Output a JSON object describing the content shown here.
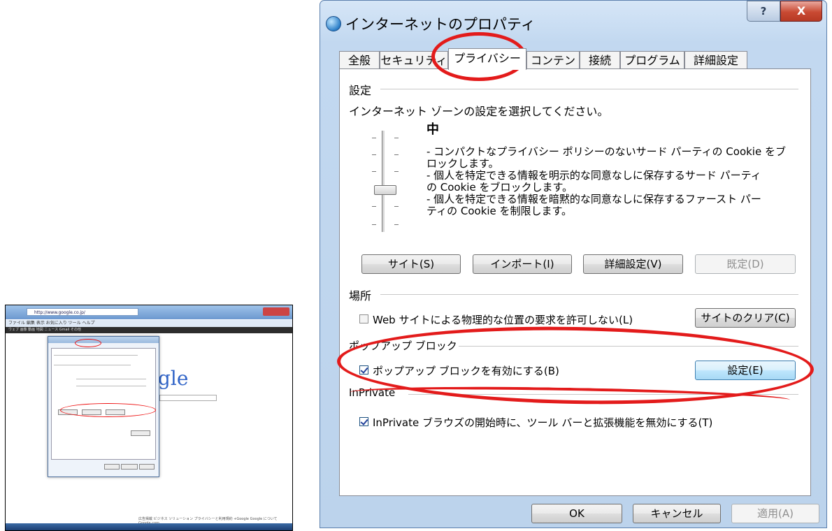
{
  "thumbnail": {
    "address": "http://www.google.co.jp/",
    "menu": "ファイル  編集  表示  お気に入り  ツール  ヘルプ",
    "gbar": "ウェブ  画像  動画  地図  ニュース  Gmail  その他",
    "logo_text": "gle",
    "footer": "広告掲載   ビジネス ソリューション   プライバシーと利用規約   +Google   Google について   Google.com"
  },
  "dialog": {
    "title": "インターネットのプロパティ",
    "help_label": "?",
    "close_label": "X",
    "tabs": [
      {
        "label": "全般"
      },
      {
        "label": "セキュリティ"
      },
      {
        "label": "プライバシー"
      },
      {
        "label": "コンテンツ"
      },
      {
        "label": "接続"
      },
      {
        "label": "プログラム"
      },
      {
        "label": "詳細設定"
      }
    ],
    "active_tab": "プライバシー",
    "settings": {
      "heading": "設定",
      "instruction": "インターネット ゾーンの設定を選択してください。",
      "level": "中",
      "description": [
        "- コンパクトなプライバシー ポリシーのないサード パーティの Cookie をブ",
        "ロックします。",
        "- 個人を特定できる情報を明示的な同意なしに保存するサード パーティ",
        "の Cookie をブロックします。",
        "- 個人を特定できる情報を暗黙的な同意なしに保存するファースト パー",
        "ティの Cookie を制限します。"
      ],
      "buttons": {
        "sites": "サイト(S)",
        "import": "インポート(I)",
        "advanced": "詳細設定(V)",
        "default": "既定(D)"
      }
    },
    "location": {
      "heading": "場所",
      "checkbox_label": "Web サイトによる物理的な位置の要求を許可しない(L)",
      "checked": false,
      "clear_button": "サイトのクリア(C)"
    },
    "popup": {
      "heading": "ポップアップ ブロック",
      "checkbox_label": "ポップアップ ブロックを有効にする(B)",
      "checked": true,
      "settings_button": "設定(E)"
    },
    "inprivate": {
      "heading": "InPrivate",
      "checkbox_label": "InPrivate ブラウズの開始時に、ツール バーと拡張機能を無効にする(T)",
      "checked": true
    },
    "footer_buttons": {
      "ok": "OK",
      "cancel": "キャンセル",
      "apply": "適用(A)"
    }
  }
}
